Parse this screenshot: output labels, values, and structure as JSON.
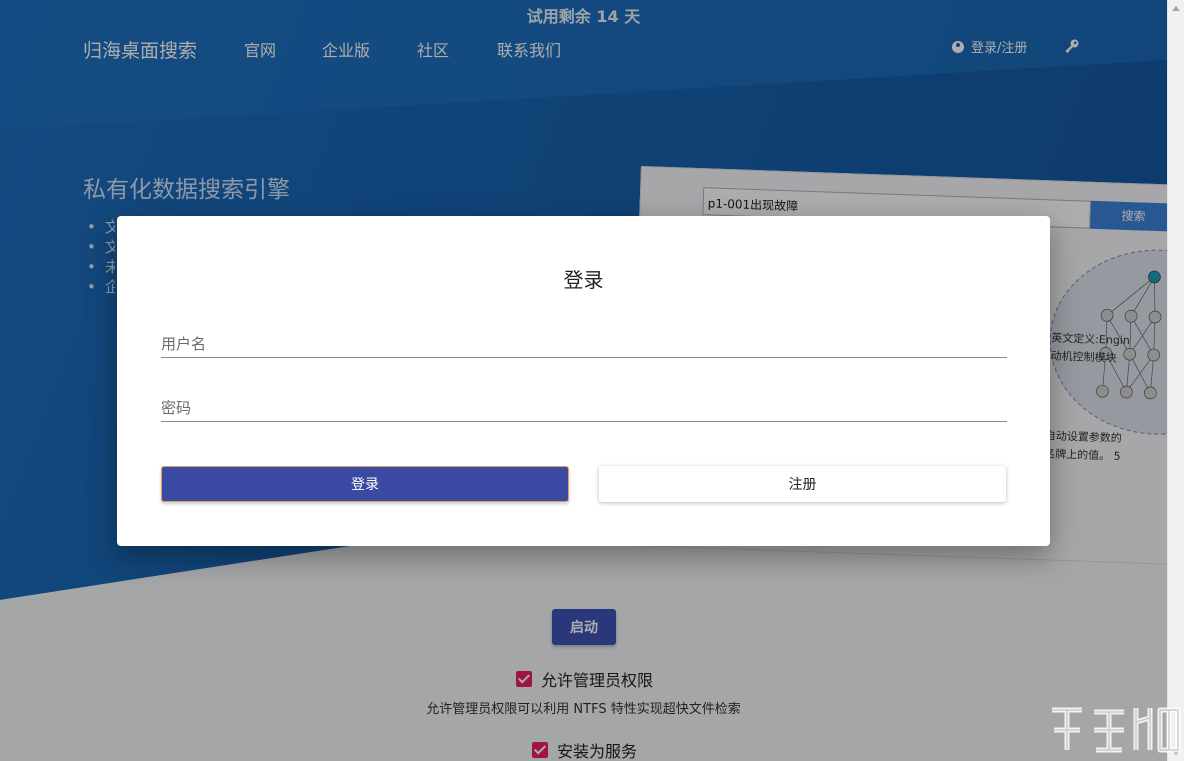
{
  "trial_banner": "试用剩余 14 天",
  "header": {
    "brand": "归海桌面搜索",
    "nav": [
      "官网",
      "企业版",
      "社区",
      "联系我们"
    ],
    "login_label": "登录/注册",
    "login_icon": "user-circle-icon",
    "settings_icon": "key-icon"
  },
  "hero": {
    "tagline": "私有化数据搜索引擎",
    "features_visible": [
      "文",
      "文",
      "未",
      "企"
    ]
  },
  "preview": {
    "search_value": "p1-001出现故障",
    "search_button": "搜索",
    "snippets": [
      "英文定义:Engin",
      "动机控制模块",
      "自动设置参数的",
      "名牌上的值。 5"
    ]
  },
  "main": {
    "start_label": "启动",
    "admin_checkbox": {
      "label": "允许管理员权限",
      "checked": true
    },
    "admin_hint": "允许管理员权限可以利用 NTFS 特性实现超快文件检索",
    "service_checkbox": {
      "label": "安装为服务",
      "checked": true
    }
  },
  "dialog": {
    "title": "登录",
    "username_placeholder": "用户名",
    "username_value": "",
    "password_placeholder": "密码",
    "password_value": "",
    "login_button": "登录",
    "register_button": "注册"
  },
  "colors": {
    "hero_blue": "#1a5ea8",
    "primary_button": "#3f51b5",
    "checkbox_accent": "#e91e63"
  }
}
